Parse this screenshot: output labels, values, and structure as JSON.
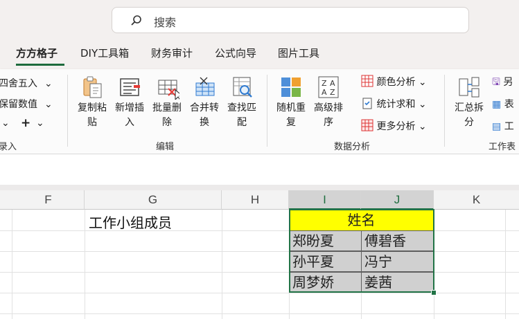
{
  "search": {
    "placeholder": "搜索"
  },
  "tabs": [
    {
      "label": "方方格子",
      "active": true
    },
    {
      "label": "DIY工具箱"
    },
    {
      "label": "财务审计"
    },
    {
      "label": "公式向导"
    },
    {
      "label": "图片工具"
    }
  ],
  "ribbon": {
    "left": {
      "round": "四舍五入",
      "keep": "保留数值",
      "plus": "+",
      "group": "录入"
    },
    "edit": {
      "copy_paste": "复制粘\n贴",
      "insert": "新增插\n入",
      "batch_delete": "批量删\n除",
      "merge": "合并转\n换",
      "find": "查找匹\n配",
      "group": "编辑"
    },
    "analysis": {
      "random_repeat": "随机重\n复",
      "advanced_sort": "高级排\n序",
      "color_analysis": "颜色分析",
      "stat_sum": "统计求和",
      "more_analysis": "更多分析",
      "group": "数据分析"
    },
    "sheet": {
      "summary_split": "汇总拆\n分",
      "save_as": "另",
      "table": "表",
      "tools": "工",
      "group": "工作表"
    }
  },
  "sheet": {
    "columns": [
      "F",
      "G",
      "H",
      "I",
      "J",
      "K"
    ],
    "title_cell": "工作小组成员",
    "header": "姓名",
    "names": [
      [
        "郑盼夏",
        "傅碧香"
      ],
      [
        "孙平夏",
        "冯宁"
      ],
      [
        "周梦娇",
        "姜茜"
      ]
    ]
  },
  "colors": {
    "accent": "#217346",
    "highlight": "#ffff00",
    "selected_fill": "#d0d0d0"
  }
}
